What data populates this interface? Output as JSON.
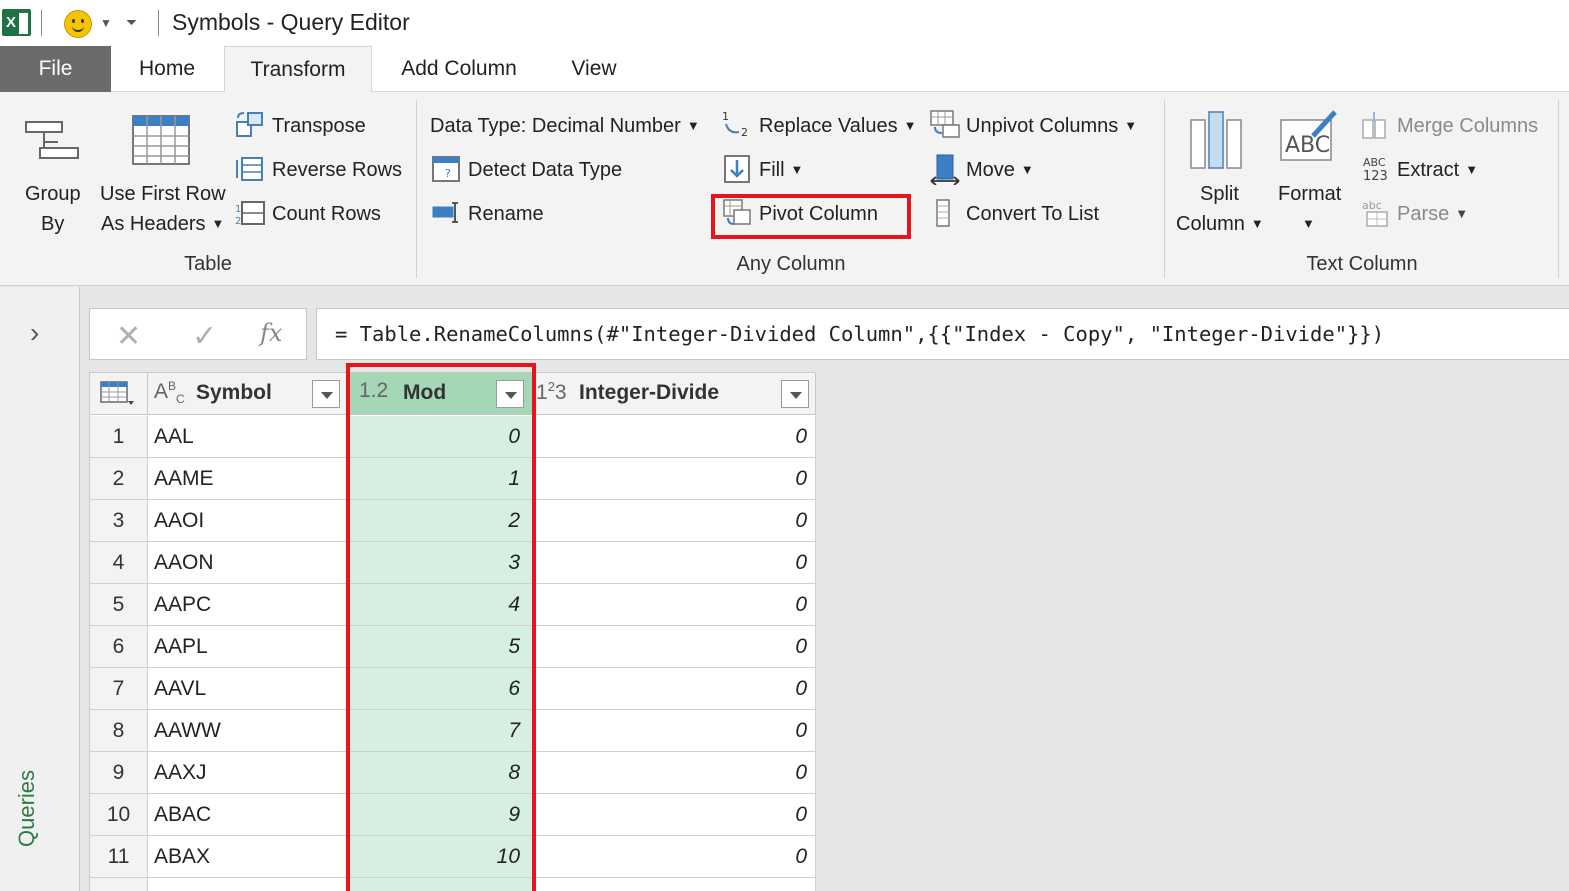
{
  "window": {
    "title": "Symbols - Query Editor"
  },
  "tabs": [
    "File",
    "Home",
    "Transform",
    "Add Column",
    "View"
  ],
  "ribbon": {
    "table_group": {
      "label": "Table",
      "group_by": [
        "Group",
        "By"
      ],
      "use_first_row": [
        "Use First Row",
        "As Headers"
      ],
      "transpose": "Transpose",
      "reverse_rows": "Reverse Rows",
      "count_rows": "Count Rows"
    },
    "any_column_group": {
      "label": "Any Column",
      "data_type": "Data Type: Decimal Number",
      "detect_data_type": "Detect Data Type",
      "rename": "Rename",
      "replace_values": "Replace Values",
      "fill": "Fill",
      "pivot_column": "Pivot Column",
      "unpivot_columns": "Unpivot Columns",
      "move": "Move",
      "convert_to_list": "Convert To List"
    },
    "text_column_group": {
      "label": "Text Column",
      "split_column": [
        "Split",
        "Column"
      ],
      "format": "Format",
      "merge_columns": "Merge Columns",
      "extract": "Extract",
      "parse": "Parse"
    }
  },
  "left_pane": {
    "label": "Queries"
  },
  "formula_bar": {
    "formula": "= Table.RenameColumns(#\"Integer-Divided Column\",{{\"Index - Copy\", \"Integer-Divide\"}})"
  },
  "table": {
    "columns": [
      {
        "type_icon": "ABC",
        "name": "Symbol"
      },
      {
        "type_icon": "1.2",
        "name": "Mod"
      },
      {
        "type_icon": "123",
        "name": "Integer-Divide"
      }
    ],
    "rows": [
      {
        "idx": "1",
        "symbol": "AAL",
        "mod": "0",
        "intdiv": "0"
      },
      {
        "idx": "2",
        "symbol": "AAME",
        "mod": "1",
        "intdiv": "0"
      },
      {
        "idx": "3",
        "symbol": "AAOI",
        "mod": "2",
        "intdiv": "0"
      },
      {
        "idx": "4",
        "symbol": "AAON",
        "mod": "3",
        "intdiv": "0"
      },
      {
        "idx": "5",
        "symbol": "AAPC",
        "mod": "4",
        "intdiv": "0"
      },
      {
        "idx": "6",
        "symbol": "AAPL",
        "mod": "5",
        "intdiv": "0"
      },
      {
        "idx": "7",
        "symbol": "AAVL",
        "mod": "6",
        "intdiv": "0"
      },
      {
        "idx": "8",
        "symbol": "AAWW",
        "mod": "7",
        "intdiv": "0"
      },
      {
        "idx": "9",
        "symbol": "AAXJ",
        "mod": "8",
        "intdiv": "0"
      },
      {
        "idx": "10",
        "symbol": "ABAC",
        "mod": "9",
        "intdiv": "0"
      },
      {
        "idx": "11",
        "symbol": "ABAX",
        "mod": "10",
        "intdiv": "0"
      }
    ]
  },
  "colors": {
    "excel_green": "#1f7244",
    "selected_column": "#d6efe0",
    "highlight_red": "#e8141c",
    "file_tab": "#6b6b6b"
  }
}
